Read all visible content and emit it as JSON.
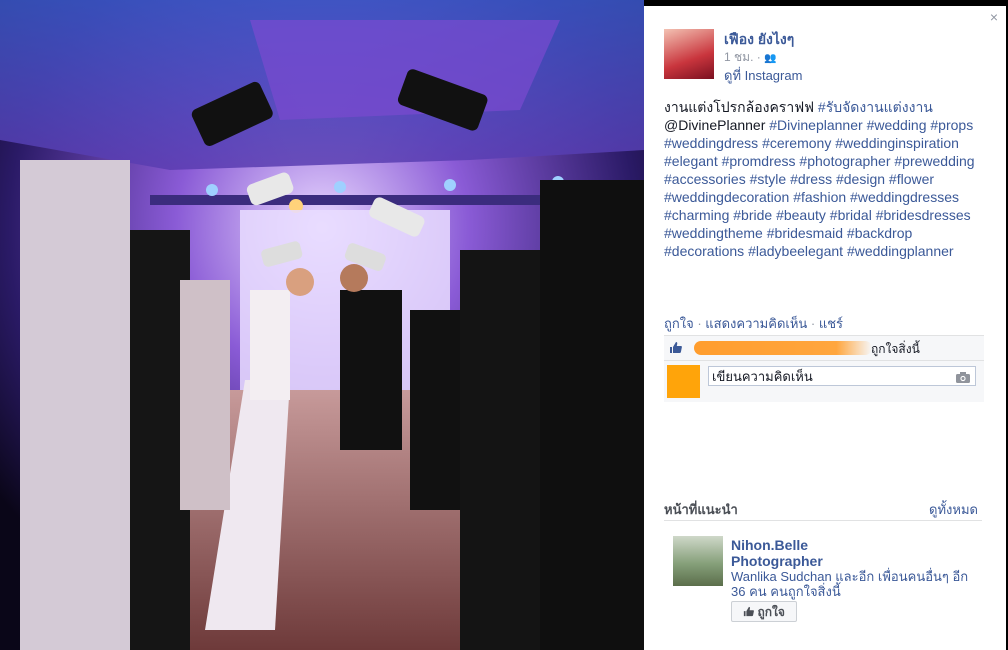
{
  "close_symbol": "×",
  "post": {
    "author": "เฟือง ยังไงๆ",
    "time": "1 ชม.",
    "privacy_icon": "friends-icon",
    "source": "ดูที่ Instagram",
    "caption_prefix": "งานแต่งโปรกล้องคราฟฟ ",
    "tags": [
      "#รับจัดงานแต่งงาน",
      "@DivinePlanner",
      "#Divineplanner",
      "#wedding",
      "#props",
      "#weddingdress",
      "#ceremony",
      "#weddinginspiration",
      "#elegant",
      "#promdress",
      "#photographer",
      "#prewedding",
      "#accessories",
      "#style",
      "#dress",
      "#design",
      "#flower",
      "#weddingdecoration",
      "#fashion",
      "#weddingdresses",
      "#charming",
      "#bride",
      "#beauty",
      "#bridal",
      "#bridesdresses",
      "#weddingtheme",
      "#bridesmaid",
      "#backdrop",
      "#decorations",
      "#ladybeelegant",
      "#weddingplanner"
    ]
  },
  "actions": {
    "like": "ถูกใจ",
    "comment": "แสดงความคิดเห็น",
    "share": "แชร์",
    "separator": " · "
  },
  "likes": {
    "suffix": "ถูกใจสิ่งนี้",
    "icon": "thumbs-up-icon"
  },
  "comment_box": {
    "placeholder": "เขียนความคิดเห็น",
    "icon": "camera-icon"
  },
  "suggested": {
    "title": "หน้าที่แนะนำ",
    "see_all": "ดูทั้งหมด",
    "page_name": "Nihon.Belle Photographer",
    "page_desc": "Wanlika Sudchan และอีก เพื่อนคนอื่นๆ อีก 36 คน คนถูกใจสิ่งนี้",
    "like_button": "ถูกใจ"
  },
  "colors": {
    "link": "#3b5998",
    "text": "#141823",
    "muted": "#9197a3",
    "accent_orange": "#ffa40a"
  }
}
